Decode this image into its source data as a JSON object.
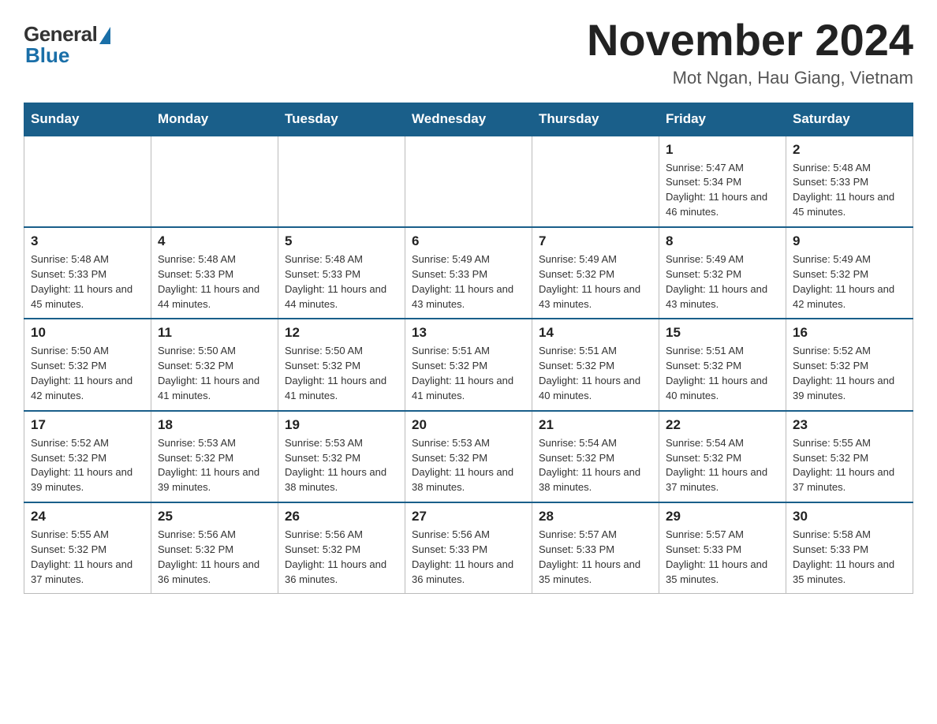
{
  "header": {
    "logo_general": "General",
    "logo_blue": "Blue",
    "month_title": "November 2024",
    "location": "Mot Ngan, Hau Giang, Vietnam"
  },
  "weekdays": [
    "Sunday",
    "Monday",
    "Tuesday",
    "Wednesday",
    "Thursday",
    "Friday",
    "Saturday"
  ],
  "weeks": [
    [
      {
        "day": "",
        "info": ""
      },
      {
        "day": "",
        "info": ""
      },
      {
        "day": "",
        "info": ""
      },
      {
        "day": "",
        "info": ""
      },
      {
        "day": "",
        "info": ""
      },
      {
        "day": "1",
        "info": "Sunrise: 5:47 AM\nSunset: 5:34 PM\nDaylight: 11 hours and 46 minutes."
      },
      {
        "day": "2",
        "info": "Sunrise: 5:48 AM\nSunset: 5:33 PM\nDaylight: 11 hours and 45 minutes."
      }
    ],
    [
      {
        "day": "3",
        "info": "Sunrise: 5:48 AM\nSunset: 5:33 PM\nDaylight: 11 hours and 45 minutes."
      },
      {
        "day": "4",
        "info": "Sunrise: 5:48 AM\nSunset: 5:33 PM\nDaylight: 11 hours and 44 minutes."
      },
      {
        "day": "5",
        "info": "Sunrise: 5:48 AM\nSunset: 5:33 PM\nDaylight: 11 hours and 44 minutes."
      },
      {
        "day": "6",
        "info": "Sunrise: 5:49 AM\nSunset: 5:33 PM\nDaylight: 11 hours and 43 minutes."
      },
      {
        "day": "7",
        "info": "Sunrise: 5:49 AM\nSunset: 5:32 PM\nDaylight: 11 hours and 43 minutes."
      },
      {
        "day": "8",
        "info": "Sunrise: 5:49 AM\nSunset: 5:32 PM\nDaylight: 11 hours and 43 minutes."
      },
      {
        "day": "9",
        "info": "Sunrise: 5:49 AM\nSunset: 5:32 PM\nDaylight: 11 hours and 42 minutes."
      }
    ],
    [
      {
        "day": "10",
        "info": "Sunrise: 5:50 AM\nSunset: 5:32 PM\nDaylight: 11 hours and 42 minutes."
      },
      {
        "day": "11",
        "info": "Sunrise: 5:50 AM\nSunset: 5:32 PM\nDaylight: 11 hours and 41 minutes."
      },
      {
        "day": "12",
        "info": "Sunrise: 5:50 AM\nSunset: 5:32 PM\nDaylight: 11 hours and 41 minutes."
      },
      {
        "day": "13",
        "info": "Sunrise: 5:51 AM\nSunset: 5:32 PM\nDaylight: 11 hours and 41 minutes."
      },
      {
        "day": "14",
        "info": "Sunrise: 5:51 AM\nSunset: 5:32 PM\nDaylight: 11 hours and 40 minutes."
      },
      {
        "day": "15",
        "info": "Sunrise: 5:51 AM\nSunset: 5:32 PM\nDaylight: 11 hours and 40 minutes."
      },
      {
        "day": "16",
        "info": "Sunrise: 5:52 AM\nSunset: 5:32 PM\nDaylight: 11 hours and 39 minutes."
      }
    ],
    [
      {
        "day": "17",
        "info": "Sunrise: 5:52 AM\nSunset: 5:32 PM\nDaylight: 11 hours and 39 minutes."
      },
      {
        "day": "18",
        "info": "Sunrise: 5:53 AM\nSunset: 5:32 PM\nDaylight: 11 hours and 39 minutes."
      },
      {
        "day": "19",
        "info": "Sunrise: 5:53 AM\nSunset: 5:32 PM\nDaylight: 11 hours and 38 minutes."
      },
      {
        "day": "20",
        "info": "Sunrise: 5:53 AM\nSunset: 5:32 PM\nDaylight: 11 hours and 38 minutes."
      },
      {
        "day": "21",
        "info": "Sunrise: 5:54 AM\nSunset: 5:32 PM\nDaylight: 11 hours and 38 minutes."
      },
      {
        "day": "22",
        "info": "Sunrise: 5:54 AM\nSunset: 5:32 PM\nDaylight: 11 hours and 37 minutes."
      },
      {
        "day": "23",
        "info": "Sunrise: 5:55 AM\nSunset: 5:32 PM\nDaylight: 11 hours and 37 minutes."
      }
    ],
    [
      {
        "day": "24",
        "info": "Sunrise: 5:55 AM\nSunset: 5:32 PM\nDaylight: 11 hours and 37 minutes."
      },
      {
        "day": "25",
        "info": "Sunrise: 5:56 AM\nSunset: 5:32 PM\nDaylight: 11 hours and 36 minutes."
      },
      {
        "day": "26",
        "info": "Sunrise: 5:56 AM\nSunset: 5:32 PM\nDaylight: 11 hours and 36 minutes."
      },
      {
        "day": "27",
        "info": "Sunrise: 5:56 AM\nSunset: 5:33 PM\nDaylight: 11 hours and 36 minutes."
      },
      {
        "day": "28",
        "info": "Sunrise: 5:57 AM\nSunset: 5:33 PM\nDaylight: 11 hours and 35 minutes."
      },
      {
        "day": "29",
        "info": "Sunrise: 5:57 AM\nSunset: 5:33 PM\nDaylight: 11 hours and 35 minutes."
      },
      {
        "day": "30",
        "info": "Sunrise: 5:58 AM\nSunset: 5:33 PM\nDaylight: 11 hours and 35 minutes."
      }
    ]
  ]
}
